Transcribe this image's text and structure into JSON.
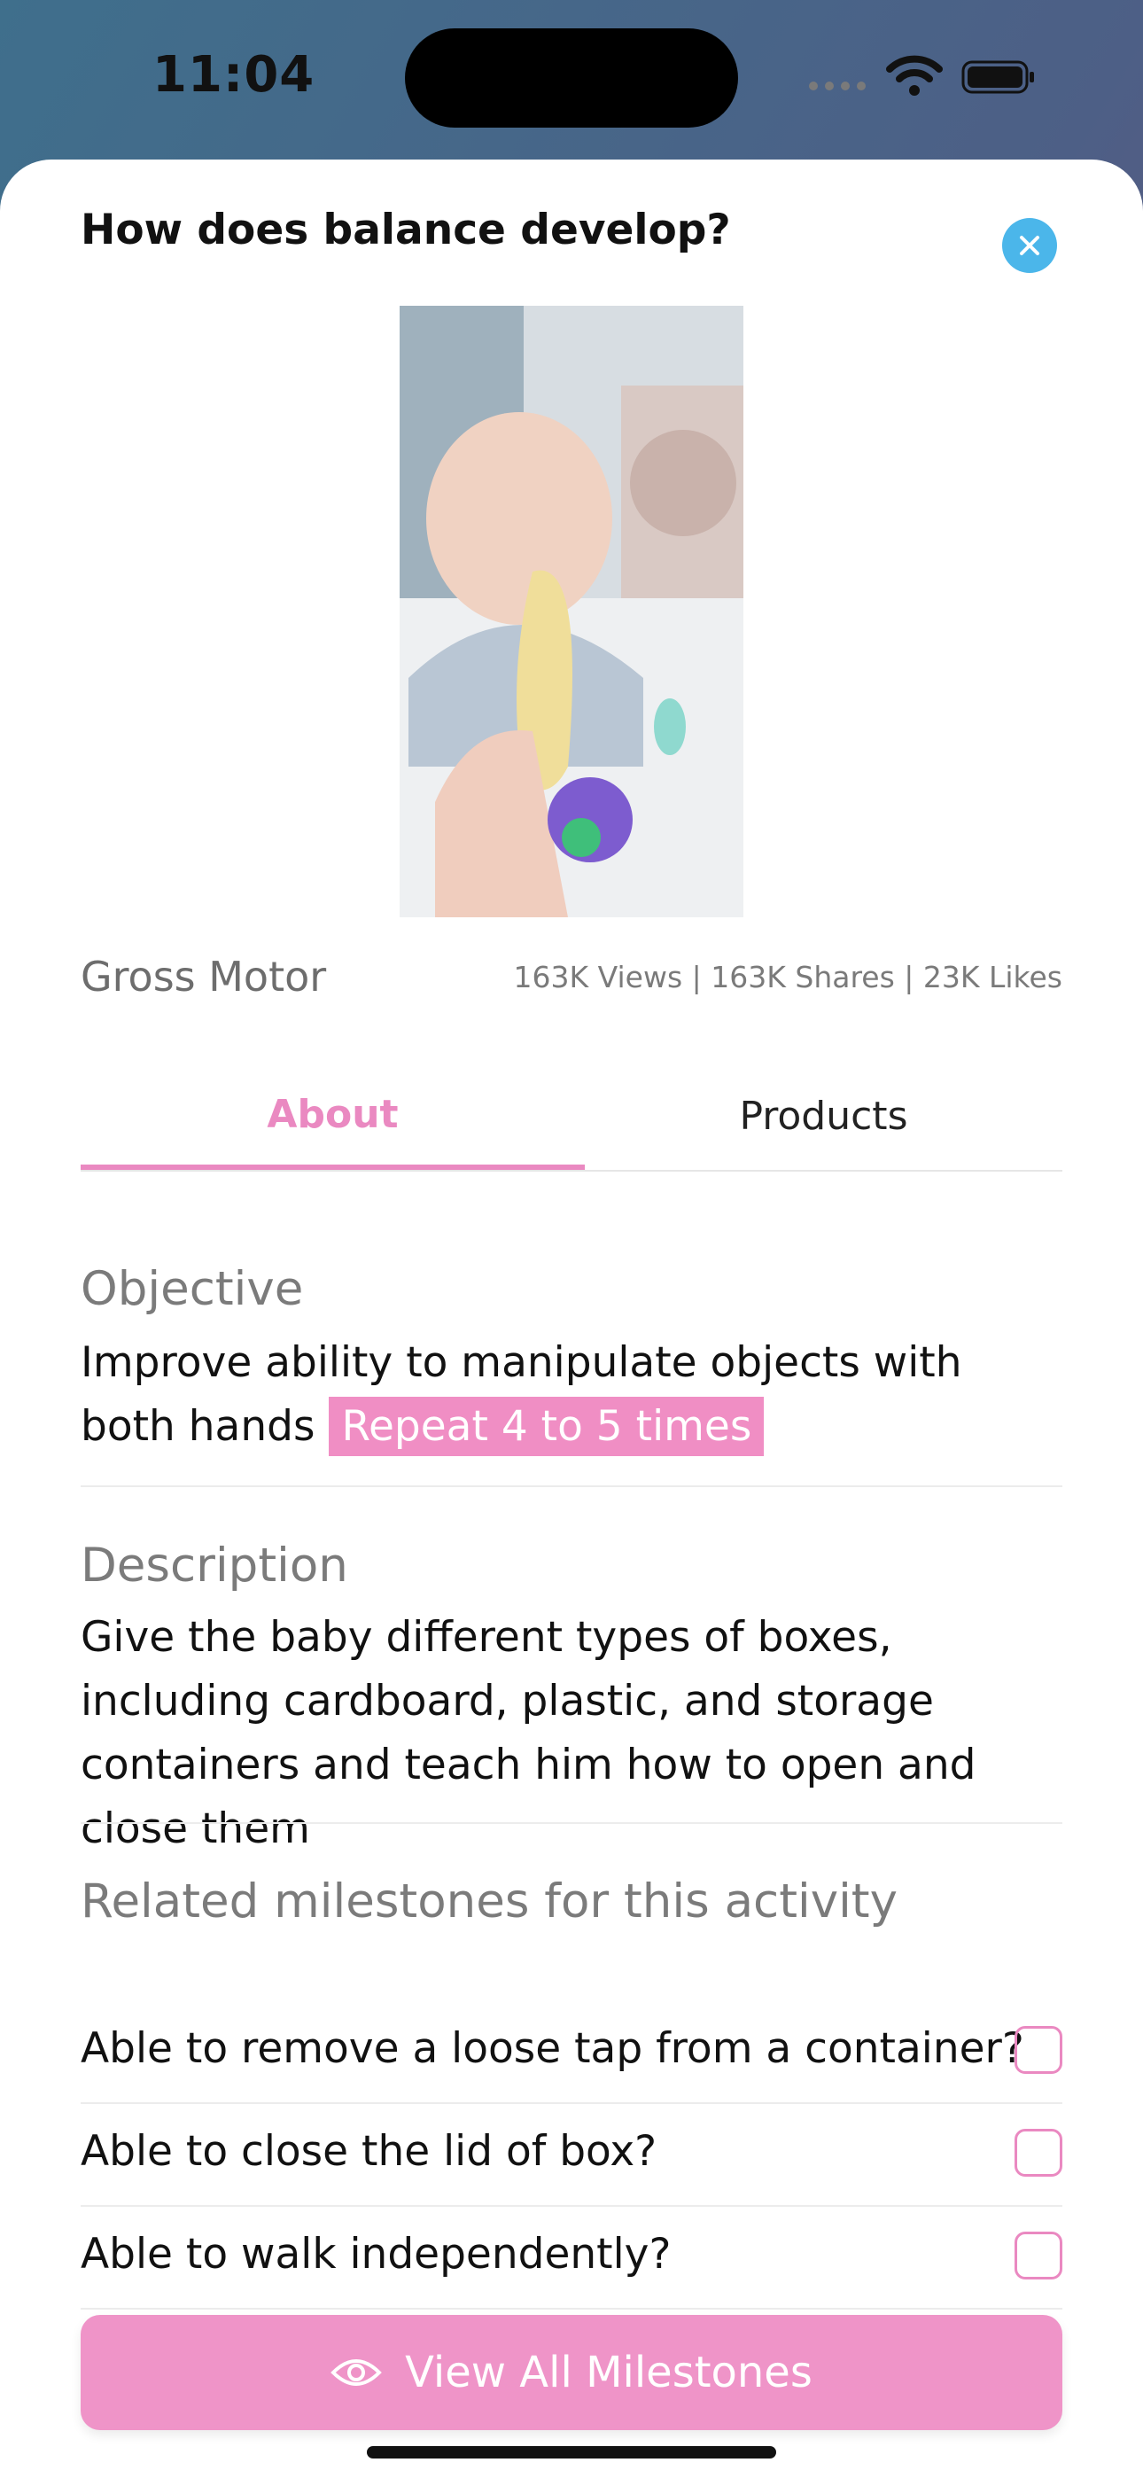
{
  "status_bar": {
    "time": "11:04"
  },
  "sheet": {
    "title": "How does balance develop?",
    "category": "Gross Motor",
    "stats": "163K Views | 163K Shares | 23K Likes"
  },
  "tabs": [
    {
      "label": "About",
      "active": true
    },
    {
      "label": "Products",
      "active": false
    }
  ],
  "about": {
    "objective_heading": "Objective",
    "objective_text": "Improve ability to manipulate objects with both hands",
    "repeat_badge": "Repeat 4 to 5 times",
    "description_heading": "Description",
    "description_text": "Give the baby different types of boxes, including cardboard, plastic, and storage containers and teach him how to open and close them",
    "milestones_heading": "Related milestones for this activity",
    "milestones": [
      {
        "label": "Able to remove a loose tap from a container?",
        "checked": false
      },
      {
        "label": "Able to close the lid of box?",
        "checked": false
      },
      {
        "label": "Able to walk independently?",
        "checked": false
      }
    ]
  },
  "cta": {
    "label": "View All Milestones"
  },
  "colors": {
    "accent": "#EA89C1",
    "close": "#4BB6EA",
    "button": "#EF94C8"
  }
}
